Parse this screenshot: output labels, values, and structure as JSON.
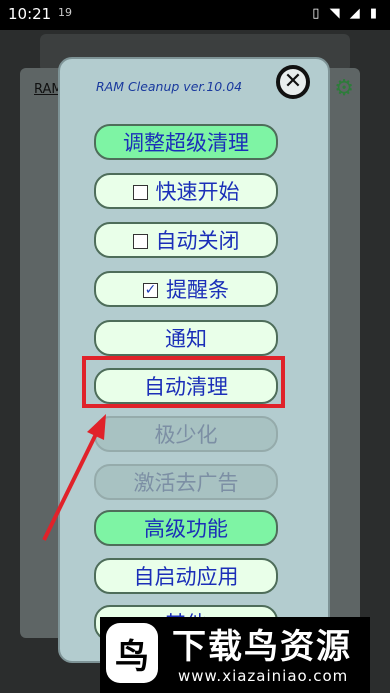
{
  "status_bar": {
    "time": "10:21",
    "extra_icon": "19",
    "icons": "vibrate-icon wifi-icon signal-icon battery-icon"
  },
  "background": {
    "label": "RAM"
  },
  "dialog": {
    "title": "RAM Cleanup ver.10.04",
    "close_glyph": "✕",
    "buttons": [
      {
        "label": "调整超级清理",
        "state": "highlighted"
      },
      {
        "label": "快速开始",
        "checkbox": true,
        "checked": false
      },
      {
        "label": "自动关闭",
        "checkbox": true,
        "checked": false
      },
      {
        "label": "提醒条",
        "checkbox": true,
        "checked": true
      },
      {
        "label": "通知"
      },
      {
        "label": "自动清理",
        "annotated": true
      },
      {
        "label": "极少化",
        "state": "disabled"
      },
      {
        "label": "激活去广告",
        "state": "disabled"
      },
      {
        "label": "高级功能",
        "state": "highlighted"
      },
      {
        "label": "自启动应用"
      },
      {
        "label": "其他"
      }
    ]
  },
  "annotation": {
    "color": "#e0222a"
  },
  "watermark": {
    "logo": "鸟",
    "title": "下载鸟资源",
    "url": "www.xiazainiao.com"
  }
}
